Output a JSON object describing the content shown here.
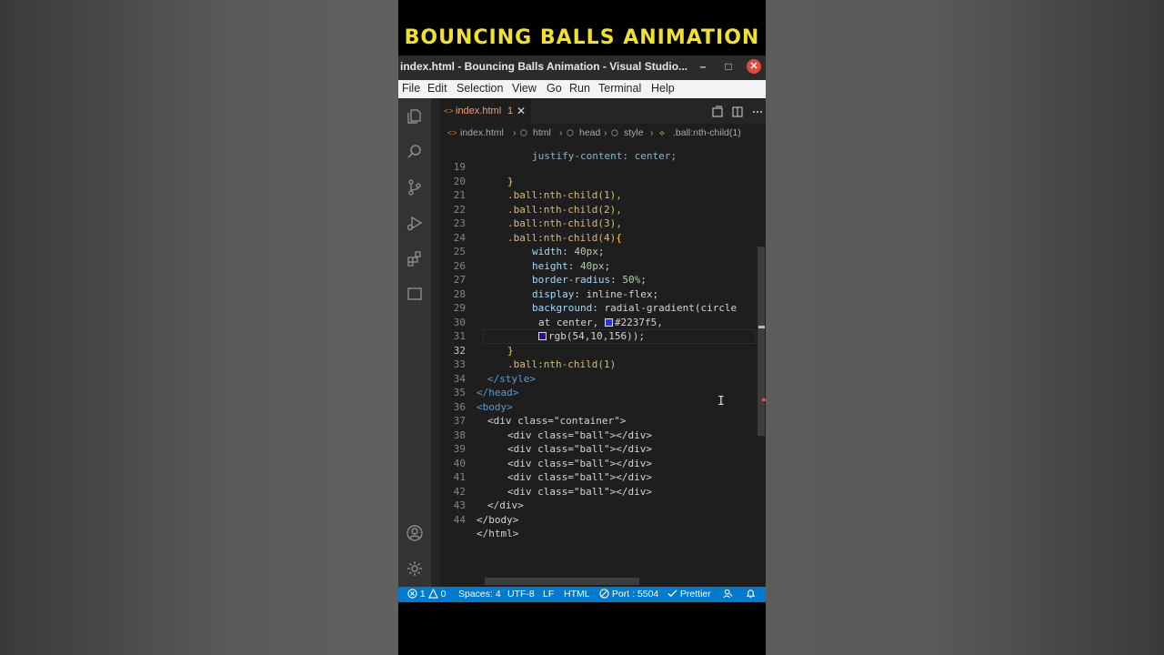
{
  "banner": {
    "text": "BOUNCING BALLS ANIMATION"
  },
  "window": {
    "title": "index.html - Bouncing Balls Animation - Visual Studio...",
    "minimize": "–",
    "maximize": "□",
    "close": "✕"
  },
  "menu": [
    "File",
    "Edit",
    "Selection",
    "View",
    "Go",
    "Run",
    "Terminal",
    "Help"
  ],
  "tab": {
    "icon": "<>",
    "filename": "index.html",
    "problems": "1",
    "close": "✕"
  },
  "breadcrumb": [
    "index.html",
    "html",
    "head",
    "style",
    ".ball:nth-child(1)"
  ],
  "code": {
    "partial_top_line": "justify-content: center;",
    "lines": [
      {
        "n": "19",
        "text": "}"
      },
      {
        "n": "20",
        "text": ".ball:nth-child(1),"
      },
      {
        "n": "21",
        "text": ".ball:nth-child(2),"
      },
      {
        "n": "22",
        "text": ".ball:nth-child(3),"
      },
      {
        "n": "23",
        "sel": ".ball:nth-child(4)",
        "brace": "{"
      },
      {
        "n": "24",
        "prop": "width",
        "val": "40px"
      },
      {
        "n": "25",
        "prop": "height",
        "val": "40px"
      },
      {
        "n": "26",
        "prop": "border-radius",
        "val": "50%"
      },
      {
        "n": "27",
        "prop": "display",
        "val": "inline-flex"
      },
      {
        "n": "28",
        "prop": "background",
        "val": "radial-gradient(circle"
      },
      {
        "n": "29",
        "text": "at center,",
        "color_text": "#2237f5,",
        "color": "#2237f5"
      },
      {
        "n": "30",
        "text": "rgb(54,10,156));",
        "color": "#360a9c"
      },
      {
        "n": "31",
        "text": "}"
      },
      {
        "n": "32",
        "text": ".ball:nth-child(1)"
      },
      {
        "n": "33",
        "text": "</style>"
      },
      {
        "n": "34",
        "text": "</head>"
      },
      {
        "n": "35",
        "text": "<body>"
      },
      {
        "n": "36",
        "text": "<div class=\"container\">"
      },
      {
        "n": "37",
        "text": "<div class=\"ball\"></div>"
      },
      {
        "n": "38",
        "text": "<div class=\"ball\"></div>"
      },
      {
        "n": "39",
        "text": "<div class=\"ball\"></div>"
      },
      {
        "n": "40",
        "text": "<div class=\"ball\"></div>"
      },
      {
        "n": "41",
        "text": "<div class=\"ball\"></div>"
      },
      {
        "n": "42",
        "text": "</div>"
      },
      {
        "n": "43",
        "text": "</body>"
      },
      {
        "n": "44",
        "text": "</html>"
      }
    ]
  },
  "status": {
    "errors": "1",
    "warnings": "0",
    "spaces": "Spaces: 4",
    "encoding": "UTF-8",
    "eol": "LF",
    "language": "HTML",
    "port": "Port : 5504",
    "formatter": "Prettier"
  },
  "colors": {
    "banner": "#f0e030",
    "statusbar": "#007acc",
    "editor_bg": "#1e1e1e",
    "close_button": "#e2483c"
  }
}
